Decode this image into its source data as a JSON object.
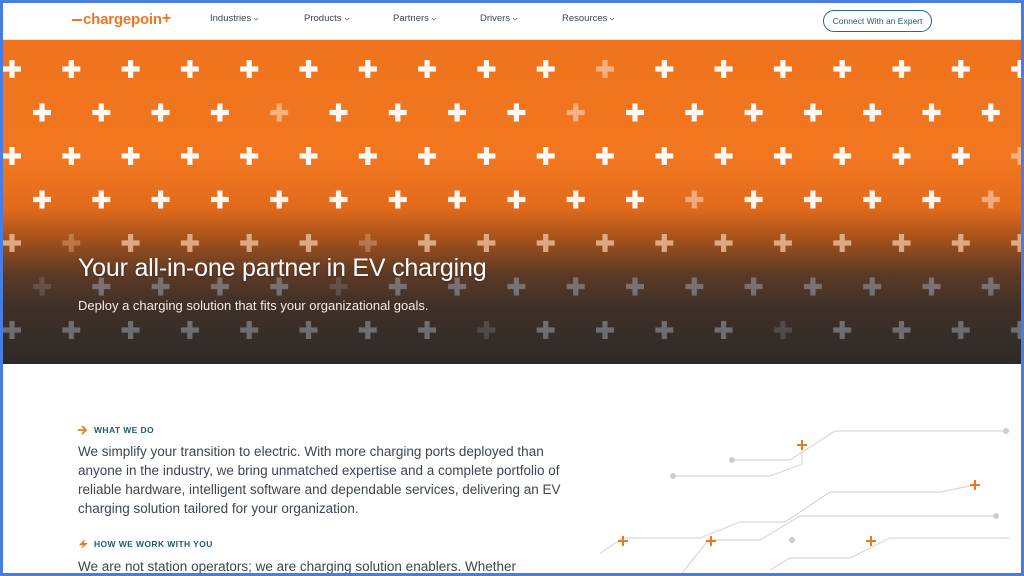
{
  "header": {
    "logo_text": "chargepoin",
    "logo_plus": "+",
    "nav": [
      {
        "label": "Industries"
      },
      {
        "label": "Products"
      },
      {
        "label": "Partners"
      },
      {
        "label": "Drivers"
      },
      {
        "label": "Resources"
      }
    ],
    "cta_label": "Connect With an Expert"
  },
  "hero": {
    "title": "Your all-in-one partner in EV charging",
    "subtitle": "Deploy a charging solution that fits your organizational goals."
  },
  "sections": [
    {
      "label": "WHAT WE DO",
      "text": "We simplify your transition to electric. With more charging ports deployed than anyone in the industry, we bring unmatched expertise and a complete portfolio of reliable hardware, intelligent software and dependable services, delivering an EV charging solution tailored for your organization."
    },
    {
      "label": "HOW WE WORK WITH YOU",
      "text": "We are not station operators; we are charging solution enablers. Whether"
    }
  ],
  "colors": {
    "brand_orange": "#ee7723",
    "teal": "#1f5d6b"
  },
  "icons": [
    "chevron-down-icon",
    "arrow-right-icon",
    "lightning-icon",
    "plus-icon"
  ]
}
